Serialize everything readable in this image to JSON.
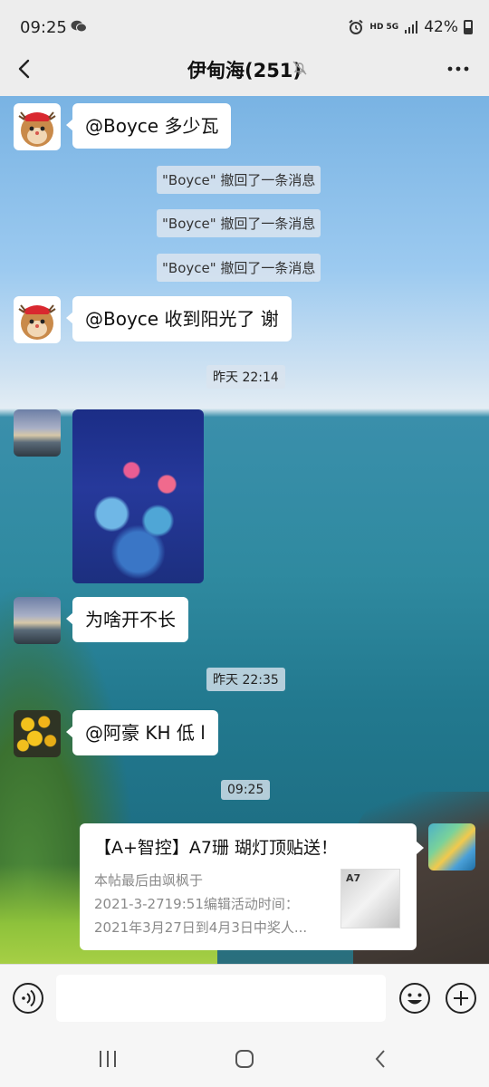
{
  "status_bar": {
    "time": "09:25",
    "network_label": "HD 5G",
    "battery": "42%",
    "battery_level": 0.42
  },
  "header": {
    "title": "伊甸海(251)",
    "back_icon": "chevron-left-icon",
    "mute_icon": "bell-off-icon",
    "more_icon": "more-horizontal-icon"
  },
  "messages": {
    "m1": {
      "text": "@Boyce  多少瓦"
    },
    "recall_1": "\"Boyce\" 撤回了一条消息",
    "recall_2": "\"Boyce\" 撤回了一条消息",
    "recall_3": "\"Boyce\" 撤回了一条消息",
    "m2": {
      "text": "@Boyce  收到阳光了 谢"
    },
    "time_1": "昨天 22:14",
    "m4": {
      "text": "为啥开不长"
    },
    "time_2": "昨天 22:35",
    "m5": {
      "text": "@阿豪  KH 低 l"
    },
    "time_3": "09:25",
    "link_card": {
      "title": "【A+智控】A7珊 瑚灯顶贴送！",
      "desc_line1": "本帖最后由飒枫于",
      "desc_line2": "2021-3-2719:51编辑活动时间：",
      "desc_line3": "2021年3月27日到4月3日中奖人...",
      "thumb_text": "A7"
    }
  },
  "input_bar": {
    "voice_icon": "voice-icon",
    "emoji_icon": "emoji-icon",
    "plus_icon": "plus-circle-icon"
  },
  "nav_bar": {
    "recent_icon": "recent-apps-icon",
    "home_icon": "home-icon",
    "back_icon": "back-icon"
  }
}
